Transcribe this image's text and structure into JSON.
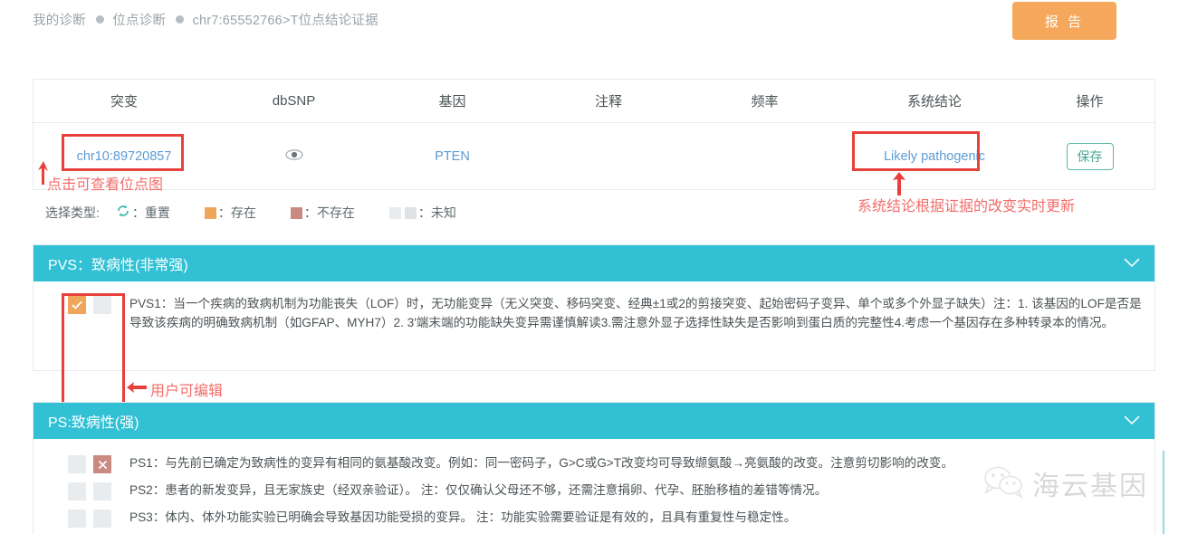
{
  "header": {
    "breadcrumb": [
      {
        "label": "我的诊断"
      },
      {
        "label": "位点诊断"
      },
      {
        "label": "chr7:65552766>T位点结论证据"
      }
    ],
    "report_button": "报 告"
  },
  "table": {
    "columns": [
      "突变",
      "dbSNP",
      "基因",
      "注释",
      "频率",
      "系统结论",
      "操作"
    ],
    "row": {
      "mutation": "chr10:89720857",
      "dbsnp_icon": "eye-icon",
      "gene": "PTEN",
      "annotation": "",
      "frequency": "",
      "conclusion": "Likely pathogenic",
      "action_label": "保存"
    }
  },
  "annotations": {
    "mutation_note": "点击可查看位点图",
    "conclusion_note": "系统结论根据证据的改变实时更新",
    "editable_note": "用户可编辑"
  },
  "legend": {
    "label": "选择类型:",
    "reset_icon": "refresh-icon",
    "items": [
      {
        "swatch": "reset",
        "text": "：重置"
      },
      {
        "swatch": "exist",
        "text": "：存在"
      },
      {
        "swatch": "nonexist",
        "text": "：不存在"
      },
      {
        "swatch": "unknown",
        "text": "：未知"
      }
    ]
  },
  "panels": [
    {
      "title": "PVS：致病性(非常强)",
      "chevron": "chevron-down-icon",
      "rows": [
        {
          "state_left": "checked",
          "state_right": "unknown",
          "text": "PVS1：当一个疾病的致病机制为功能丧失（LOF）时，无功能变异（无义突变、移码突变、经典±1或2的剪接突变、起始密码子变异、单个或多个外显子缺失）注：1. 该基因的LOF是否是导致该疾病的明确致病机制（如GFAP、MYH7）2. 3'端末端的功能缺失变异需谨慎解读3.需注意外显子选择性缺失是否影响到蛋白质的完整性4.考虑一个基因存在多种转录本的情况。"
        }
      ]
    },
    {
      "title": "PS:致病性(强)",
      "chevron": "chevron-down-icon",
      "rows": [
        {
          "state_left": "unknown",
          "state_right": "cross",
          "text": "PS1：与先前已确定为致病性的变异有相同的氨基酸改变。例如：同一密码子，G>C或G>T改变均可导致缬氨酸→亮氨酸的改变。注意剪切影响的改变。"
        },
        {
          "state_left": "unknown",
          "state_right": "unknown",
          "text": "PS2：患者的新发变异，且无家族史（经双亲验证）。 注：仅仅确认父母还不够，还需注意捐卵、代孕、胚胎移植的差错等情况。"
        },
        {
          "state_left": "unknown",
          "state_right": "unknown",
          "text": "PS3：体内、体外功能实验已明确会导致基因功能受损的变异。 注：功能实验需要验证是有效的，且具有重复性与稳定性。"
        }
      ]
    }
  ],
  "watermark": {
    "text": "海云基因",
    "icon": "wechat-icon"
  },
  "colors": {
    "panel_header": "#31c0d4",
    "report_button": "#f5a85c",
    "exist": "#f0a65a",
    "nonexist": "#c98a82",
    "unknown": "#e9ecee",
    "annotation_red": "#e8413c",
    "link": "#5b9bd5"
  }
}
